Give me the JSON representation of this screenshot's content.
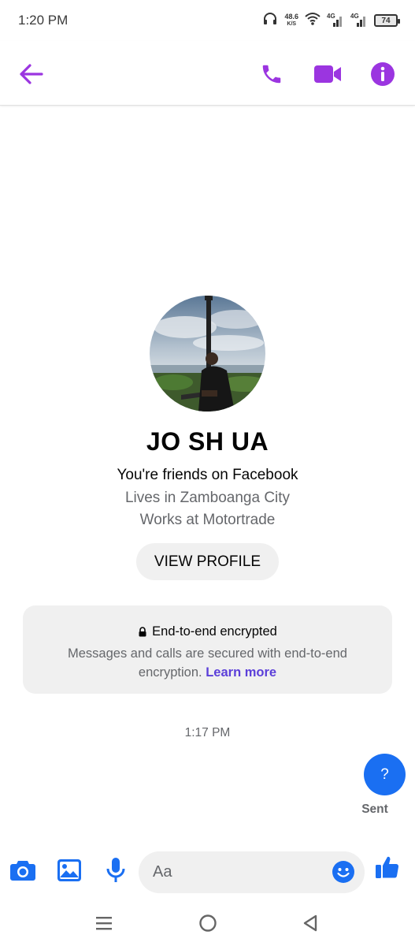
{
  "status_bar": {
    "time": "1:20 PM",
    "speed_value": "48.6",
    "speed_unit": "K/S",
    "network1": "4G",
    "network2": "4G",
    "battery": "74"
  },
  "header": {
    "back_icon": "arrow-left-icon",
    "call_icon": "phone-icon",
    "video_icon": "video-camera-icon",
    "info_icon": "info-icon",
    "accent_color": "#9b35e0"
  },
  "profile": {
    "name": "JO SH UA",
    "friends_text": "You're friends on Facebook",
    "lives_text": "Lives in Zamboanga City",
    "works_text": "Works at Motortrade",
    "view_profile_label": "VIEW PROFILE"
  },
  "encryption": {
    "title": "End-to-end encrypted",
    "body": "Messages and calls are secured with end-to-end encryption.",
    "link": "Learn more"
  },
  "conversation": {
    "timestamp": "1:17 PM",
    "sent_message": "?",
    "sent_status": "Sent",
    "bubble_color": "#1a6ff2"
  },
  "composer": {
    "placeholder": "Aa",
    "camera_icon": "camera-icon",
    "gallery_icon": "image-icon",
    "mic_icon": "microphone-icon",
    "emoji_icon": "emoji-icon",
    "like_icon": "thumbs-up-icon",
    "accent_color": "#1a6ff2"
  },
  "nav_bar": {
    "menu_icon": "menu-icon",
    "home_icon": "home-circle-icon",
    "back_icon": "back-triangle-icon"
  }
}
